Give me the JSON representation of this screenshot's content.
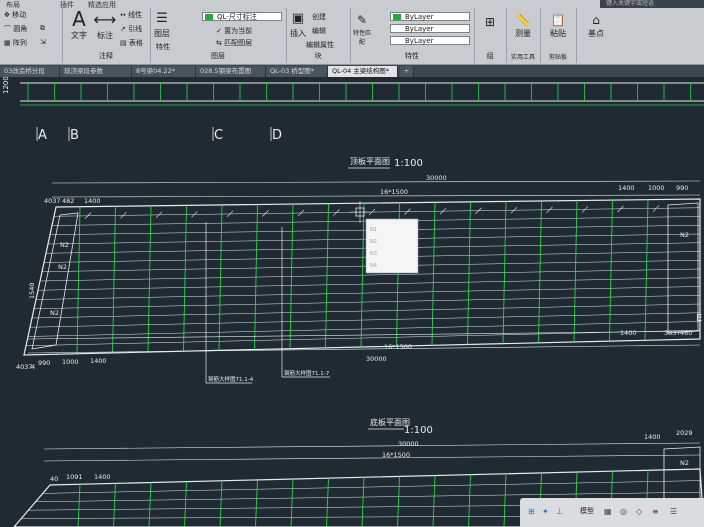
{
  "ribbon": {
    "tabs": [
      "布局",
      "插件",
      "精选应用"
    ],
    "draw_tools": [
      "移动",
      "圆角",
      "阵列",
      "复制",
      "拉伸"
    ],
    "annotation": {
      "text_label": "文字",
      "dimension_label": "标注",
      "linear": "线性",
      "leader": "引线",
      "table": "表格",
      "panel_label": "注释"
    },
    "layers": {
      "layer_props_label": "图层",
      "layer_combo": "QL-尺寸标注",
      "set_current": "置为当前",
      "match_layer": "匹配图层",
      "panel_label": "图层",
      "prop_label": "特性"
    },
    "block": {
      "insert": "插入",
      "create": "创建",
      "edit": "编辑",
      "edit_attr": "编辑属性",
      "panel_label": "块"
    },
    "properties": {
      "match_label": "特性匹配",
      "color": "ByLayer",
      "linetype": "ByLayer",
      "lineweight": "ByLayer",
      "panel_label": "特性"
    },
    "groups": {
      "label": "组"
    },
    "utilities": {
      "measure": "测量",
      "panel_label": "实用工具"
    },
    "clipboard": {
      "paste": "粘贴",
      "panel_label": "剪贴板"
    },
    "view": {
      "base": "基点"
    },
    "search_placeholder": "键入关键字或短语"
  },
  "doc_tabs": [
    {
      "label": "03改造桥分段",
      "active": false
    },
    {
      "label": "现浇梁段参数",
      "active": false
    },
    {
      "label": "8号梁04.22*",
      "active": false
    },
    {
      "label": "028.5钢梁布置图",
      "active": false
    },
    {
      "label": "QL-03 桥型图*",
      "active": false
    },
    {
      "label": "QL-04 主梁结构图*",
      "active": true
    }
  ],
  "drawing": {
    "axis_labels": [
      "A",
      "B",
      "C",
      "D"
    ],
    "top_dim_left": "1200",
    "top_plan": {
      "title": "顶板平面图",
      "scale": "1:100",
      "overall": "30000",
      "spacing_top": "16*1500",
      "spacing_bottom": "16*1500",
      "overall_bottom": "30000",
      "left_top_dims": [
        "4037",
        "482",
        "1400"
      ],
      "right_top_dims": [
        "1400",
        "1000",
        "990"
      ],
      "left_bottom_dims": [
        "4037",
        "4",
        "990",
        "1000",
        "1400"
      ],
      "right_bottom_dims": [
        "1400",
        "3837",
        "460"
      ],
      "left_side_dims": [
        "1540"
      ],
      "n_labels": [
        "N2",
        "N2",
        "N2",
        "N2"
      ],
      "callout_1": "钢筋大样图71.1-4",
      "callout_2": "钢筋大样图71.1-7",
      "grid_letter": "E"
    },
    "bottom_plan": {
      "title": "底板平面图",
      "scale": "1:100",
      "overall": "30000",
      "spacing": "16*1500",
      "left_dims": [
        "40",
        "1091",
        "1400"
      ],
      "right_dims": [
        "1400",
        "2029"
      ],
      "n_label": "N2"
    },
    "popup_lines": [
      "N1",
      "N2",
      "N3",
      "N4"
    ]
  },
  "status": {
    "model_label": "模型"
  },
  "colors": {
    "background": "#1f2a33",
    "rebar": "#27d64a",
    "outline": "#e8ecef",
    "ribbon": "#c8ccd0"
  }
}
